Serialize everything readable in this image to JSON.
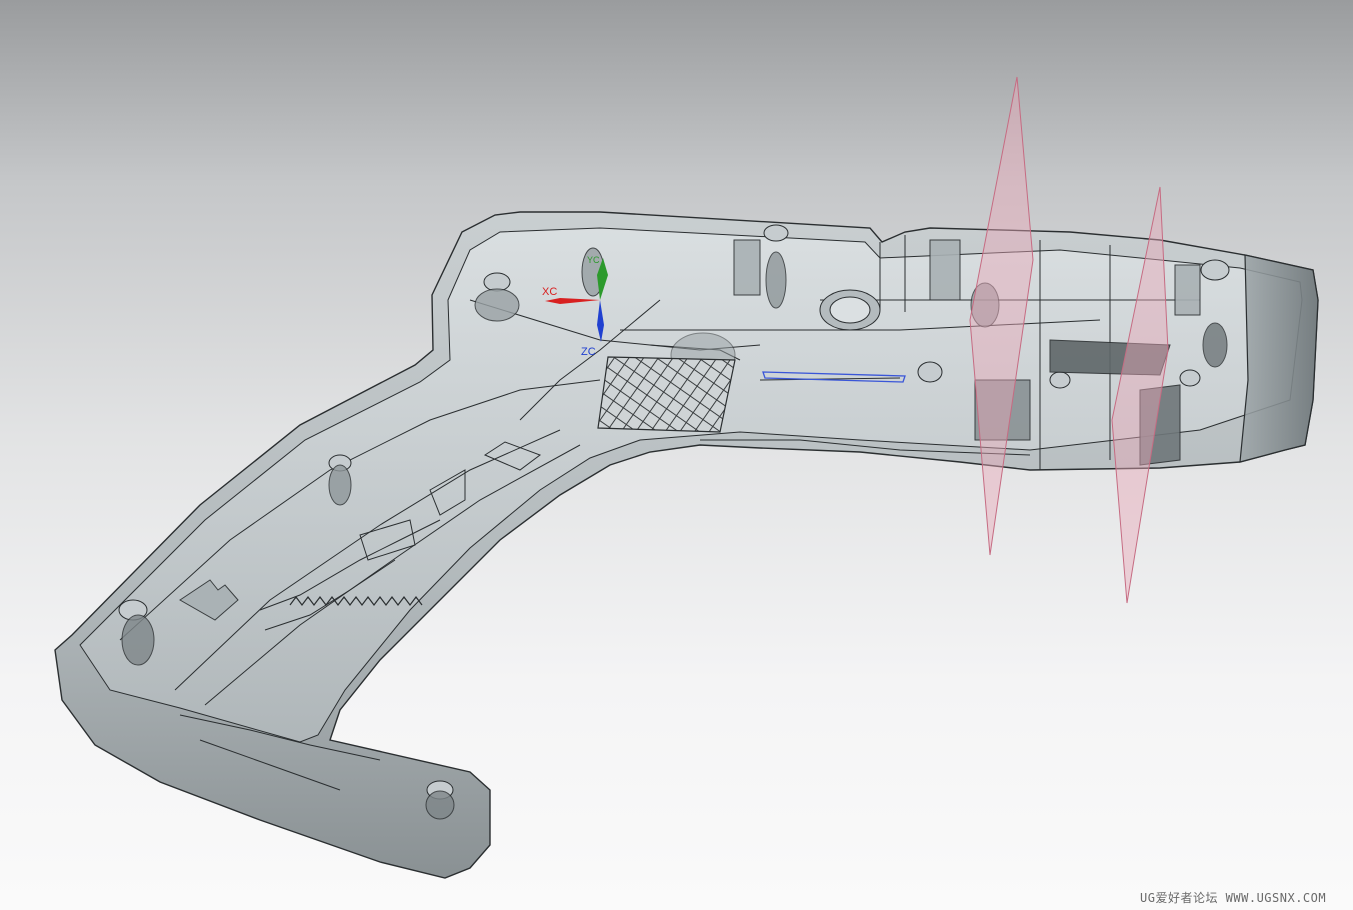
{
  "viewport": {
    "background_top": "#9a9c9e",
    "background_bottom": "#fafafa",
    "model_body_color": "#9aa3a6",
    "edge_color": "#2a2e30",
    "datum_plane_color": "#e8a8b8"
  },
  "wcs_triad": {
    "x_label": "XC",
    "y_label": "YC",
    "z_label": "ZC",
    "x_color": "#d82020",
    "y_color": "#2c9a2c",
    "z_color": "#2040d0"
  },
  "watermark": {
    "text": "UG爱好者论坛 WWW.UGSNX.COM"
  }
}
